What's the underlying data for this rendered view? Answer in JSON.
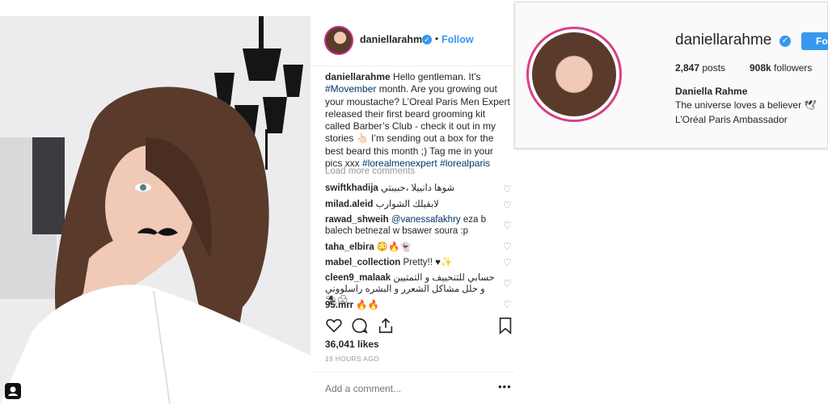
{
  "post": {
    "username": "daniellarahme",
    "separator": "•",
    "follow_label": "Follow",
    "caption": {
      "username": "daniellarahme",
      "part1": " Hello gentleman. It’s ",
      "hashtag1": "#Movember",
      "part2": " month. Are you growing out your moustache? L’Oreal Paris Men Expert released their first beard grooming kit called Barber’s Club - check it out in my stories 👆🏻 I’m sending out a box for the best beard this month ;) Tag me in your pics xxx ",
      "hashtag2": "#lorealmenexpert",
      "hashtag3": "#lorealparis"
    },
    "load_more": "Load more comments",
    "comments": [
      {
        "user": "swiftkhadija",
        "text": "شوها دانييلا ،حبيبتي"
      },
      {
        "user": "milad.aleid",
        "text": "لابقيلك الشوارب"
      },
      {
        "user": "rawad_shweih",
        "mention": "@vanessafakhry",
        "text": " eza b balech betnezal w bsawer soura :p"
      },
      {
        "user": "taha_elbira",
        "text": " 😳🔥👻"
      },
      {
        "user": "mabel_collection",
        "text": " Pretty!! ♥✨"
      },
      {
        "user": "cleen9_malaak",
        "text": " حسابي للتنحييف و التمتيين و حلل مشاكل الشعرر و البشره راسلووني ⛱☘"
      },
      {
        "user": "95.mrr",
        "text": " 🔥🔥"
      }
    ],
    "likes": "36,041 likes",
    "time": "19 HOURS AGO",
    "add_comment_placeholder": "Add a comment...",
    "more_label": "•••"
  },
  "profile": {
    "username": "daniellarahme",
    "follow_label": "Follow",
    "posts_count": "2,847",
    "posts_label": " posts",
    "followers_count": "908k",
    "followers_label": " followers",
    "full_name": "Daniella Rahme",
    "bio_line1": "The universe loves a believer 🕊",
    "bio_line2": "L’Oréal Paris Ambassador"
  },
  "icons": {
    "heart": "heart-icon",
    "comment": "comment-icon",
    "share": "share-icon",
    "bookmark": "bookmark-icon",
    "verified": "verified-badge-icon",
    "tag_user": "user-tag-icon"
  },
  "colors": {
    "link_blue": "#3897f0",
    "hashtag": "#003569",
    "muted": "#999999"
  }
}
